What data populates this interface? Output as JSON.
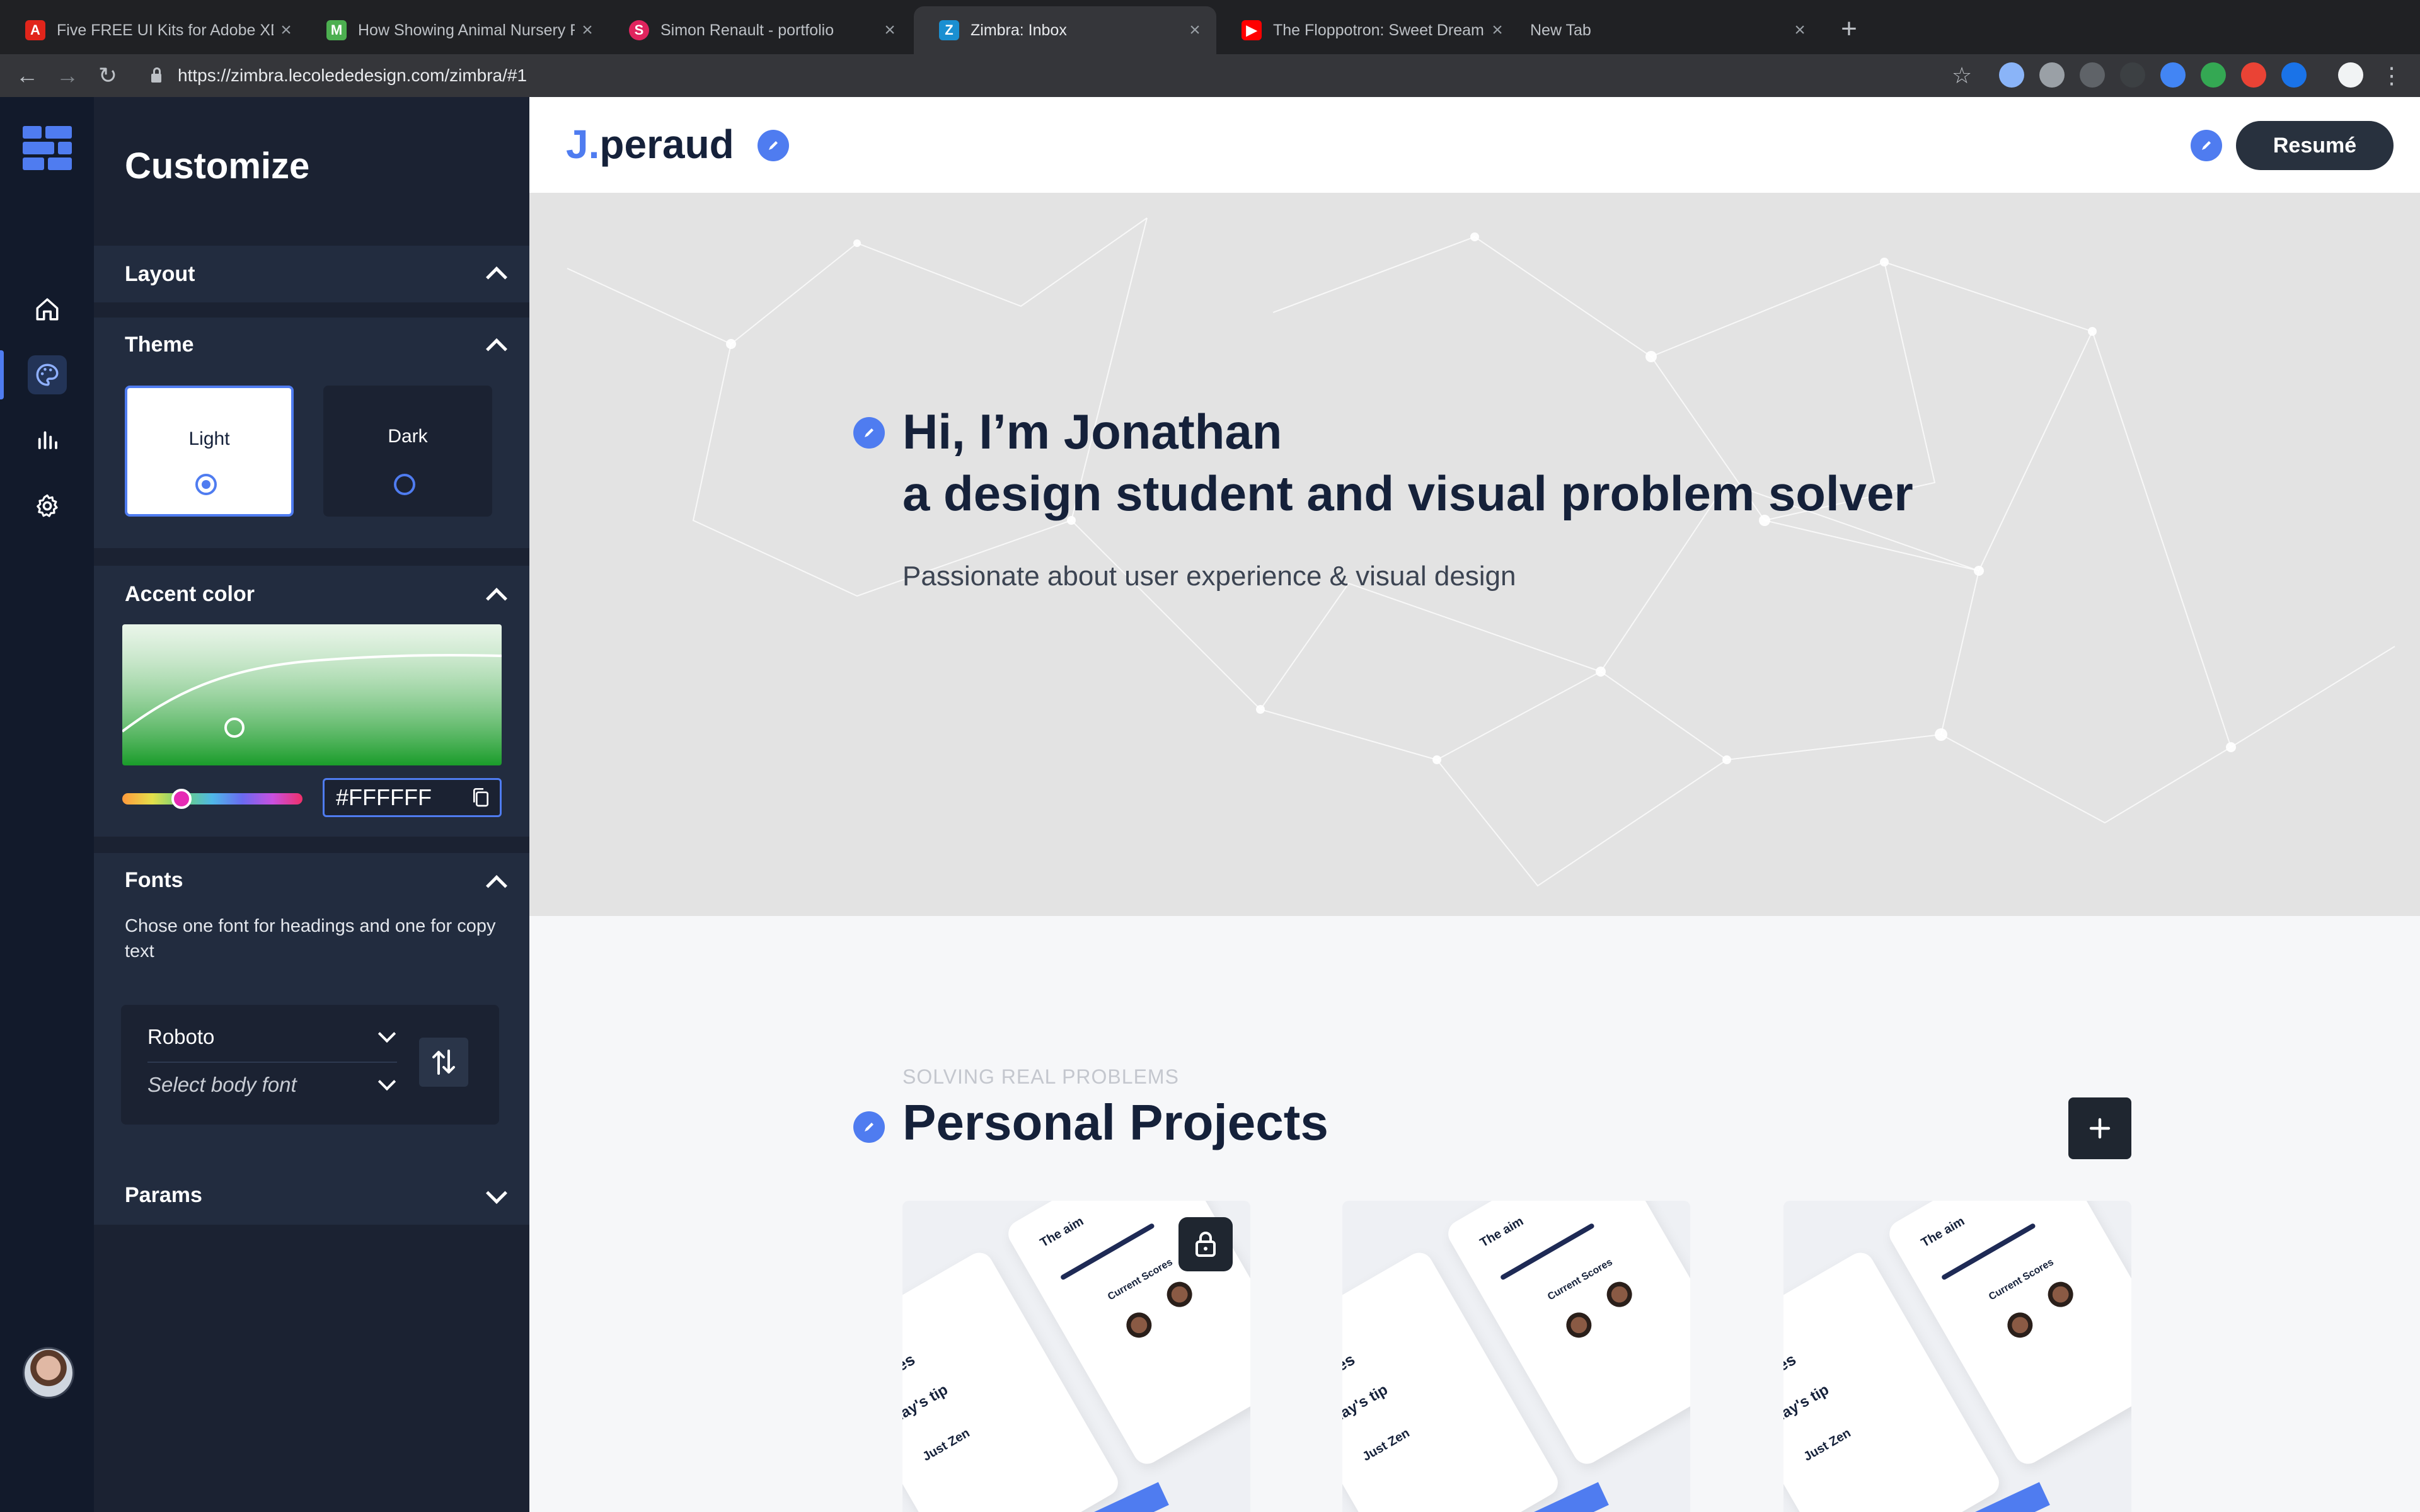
{
  "browser": {
    "tabs": [
      {
        "title": "Five FREE UI Kits for Adobe XD",
        "active": false
      },
      {
        "title": "How Showing Animal Nursery R",
        "active": false
      },
      {
        "title": "Simon Renault - portfolio",
        "active": false
      },
      {
        "title": "Zimbra: Inbox",
        "active": true
      },
      {
        "title": "The Floppotron: Sweet Dreams",
        "active": false
      },
      {
        "title": "New Tab",
        "active": false
      }
    ],
    "url": "https://zimbra.lecolededesign.com/zimbra/#1"
  },
  "sidebar": {
    "icons": [
      "logo-icon",
      "home-icon",
      "palette-icon",
      "chart-icon",
      "gear-icon"
    ],
    "active": "palette-icon"
  },
  "panel": {
    "title": "Customize",
    "layout_label": "Layout",
    "theme_label": "Theme",
    "theme_options": [
      {
        "label": "Light",
        "selected": true
      },
      {
        "label": "Dark",
        "selected": false
      }
    ],
    "accent_label": "Accent color",
    "accent_hex": "#FFFFFF",
    "fonts_label": "Fonts",
    "fonts_help": "Chose one font for headings and one for copy text",
    "heading_font": "Roboto",
    "body_font_placeholder": "Select body font",
    "params_label": "Params"
  },
  "main": {
    "brand_prefix": "J.",
    "brand_name": "peraud",
    "resume_label": "Resumé",
    "hero_line1": "Hi, I’m Jonathan",
    "hero_line2": "a design student and visual problem solver",
    "hero_sub": "Passionate about user experience & visual design",
    "kicker": "SOLVING REAL PROBLEMS",
    "projects_title": "Personal Projects",
    "card_texts": {
      "aim": "The aim",
      "scores": "Current Scores",
      "challenges": "enges",
      "tip": "day's tip",
      "zen": "Just Zen"
    }
  },
  "colors": {
    "accent": "#4f7cf0",
    "navy": "#15213a",
    "panel": "#1b2232"
  }
}
